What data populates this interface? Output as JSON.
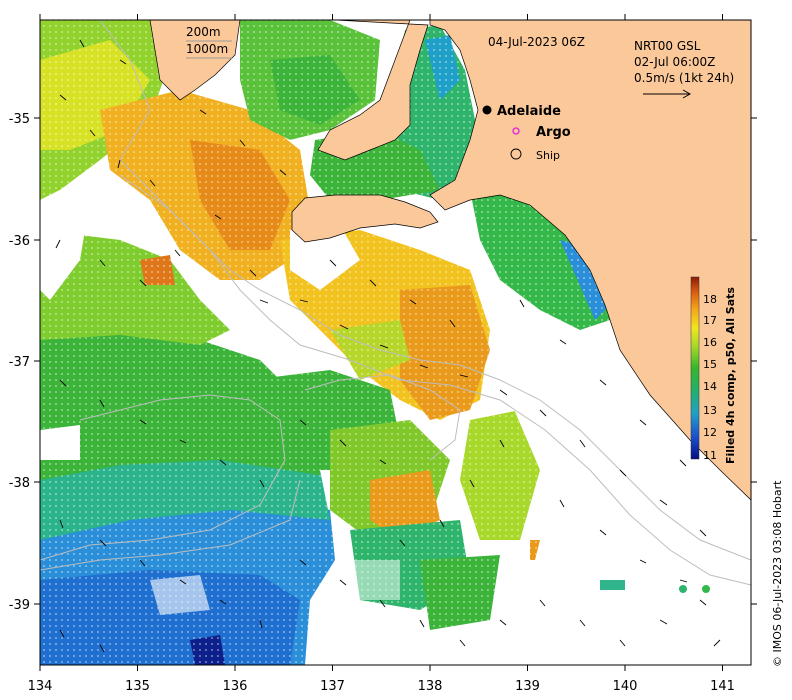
{
  "map": {
    "date_label": "04-Jul-2023 06Z",
    "legend_depth": [
      "200m",
      "1000m"
    ],
    "current_info": [
      "NRT00 GSL",
      "02-Jul 06:00Z",
      "0.5m/s (1kt 24h)"
    ],
    "places": [
      {
        "name": "Adelaide",
        "marker": "city"
      },
      {
        "name": "Argo",
        "marker": "argo"
      },
      {
        "name": "Ship",
        "marker": "ship"
      }
    ],
    "x_ticks": [
      "134",
      "135",
      "136",
      "137",
      "138",
      "139",
      "140",
      "141"
    ],
    "y_ticks": [
      "-35",
      "-36",
      "-37",
      "-38",
      "-39"
    ],
    "colorbar": {
      "title": "Filled 4h comp, p50, All Sats",
      "ticks": [
        "18",
        "17",
        "16",
        "15",
        "14",
        "13",
        "12",
        "11"
      ]
    },
    "credit": "© IMOS 06-Jul-2023 03:08 Hobart",
    "colors": {
      "land": "#fbc89a",
      "no_data": "#ffffff",
      "warm": "#e9931a",
      "mild": "#b9d62c",
      "cool": "#2faa3a",
      "cold": "#1b78d4"
    }
  }
}
